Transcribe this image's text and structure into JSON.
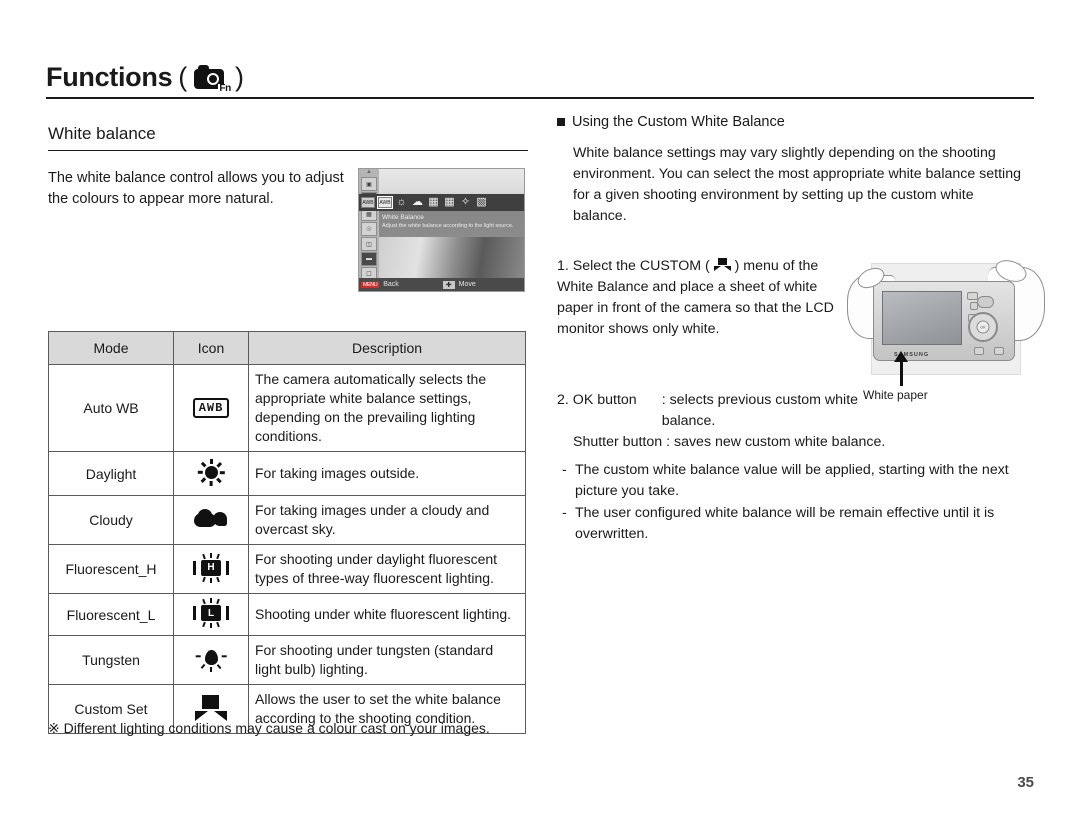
{
  "header": {
    "title": "Functions",
    "open_paren": "(",
    "close_paren": ")",
    "icon_name": "camera-fn-icon",
    "fn_label": "Fn"
  },
  "section": {
    "heading": "White balance",
    "intro": "The white balance control allows you to adjust the colours to appear more natural."
  },
  "lcd_screenshot": {
    "menu_title": "White Balance",
    "menu_description": "Adjust the white balance according to the light source.",
    "bottom_left_key": "MENU",
    "bottom_left_label": "Back",
    "bottom_right_label": "Move",
    "icon_bar": [
      "AWB",
      "AWB2",
      "sun",
      "cloud",
      "fluorescent-h",
      "fluorescent-l",
      "tungsten",
      "custom"
    ]
  },
  "table": {
    "headers": [
      "Mode",
      "Icon",
      "Description"
    ],
    "rows": [
      {
        "mode": "Auto WB",
        "icon": "awb-icon",
        "icon_text": "AWB",
        "description": "The camera automatically selects the appropriate white balance settings, depending on the prevailing lighting conditions."
      },
      {
        "mode": "Daylight",
        "icon": "sun-icon",
        "icon_text": "",
        "description": "For taking images outside."
      },
      {
        "mode": "Cloudy",
        "icon": "cloud-icon",
        "icon_text": "",
        "description": "For taking images under a cloudy and overcast sky."
      },
      {
        "mode": "Fluorescent_H",
        "icon": "fluorescent-h-icon",
        "icon_text": "H",
        "description": "For shooting under daylight fluorescent types of three-way fluorescent lighting."
      },
      {
        "mode": "Fluorescent_L",
        "icon": "fluorescent-l-icon",
        "icon_text": "L",
        "description": "Shooting under white fluorescent lighting."
      },
      {
        "mode": "Tungsten",
        "icon": "tungsten-icon",
        "icon_text": "",
        "description": "For shooting under tungsten (standard light bulb) lighting."
      },
      {
        "mode": "Custom Set",
        "icon": "custom-set-icon",
        "icon_text": "",
        "description": "Allows the user to set the white balance according to the shooting condition."
      }
    ]
  },
  "footnote": "※ Different lighting conditions may cause a colour cast on your images.",
  "right": {
    "bullet_heading": "Using the Custom White Balance",
    "paragraph": "White balance settings may vary slightly depending on the shooting environment. You can select the most appropriate white balance setting for a given shooting environment by setting up the custom white balance.",
    "step1_number": "1.",
    "step1_pre": "Select the CUSTOM (",
    "step1_post": ") menu of the White Balance and place a sheet of white paper in front of the camera so that the LCD monitor shows only white.",
    "step2_number": "2.",
    "step2_ok_label": "OK button",
    "step2_ok_value": ": selects previous custom white balance.",
    "step2_shutter_label": "Shutter button",
    "step2_shutter_value": ": saves new custom white balance.",
    "dash_items": [
      "The custom white balance value will be applied, starting with the next picture you take.",
      "The user configured white balance will be remain effective until it is overwritten."
    ],
    "dash_mark": "-"
  },
  "illustration": {
    "camera_brand": "SAMSUNG",
    "ok_label": "OK",
    "white_paper_label": "White paper"
  },
  "page_number": "35"
}
